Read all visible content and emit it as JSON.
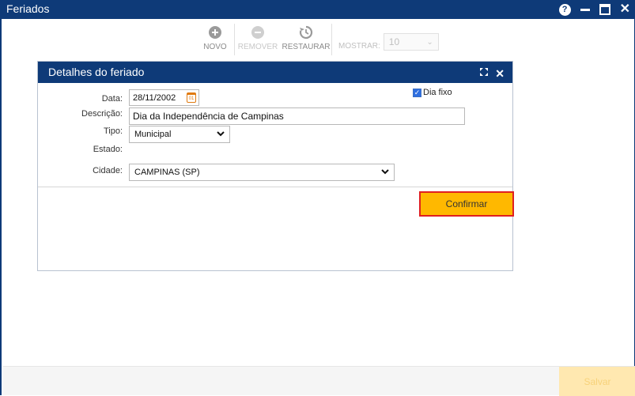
{
  "window": {
    "title": "Feriados"
  },
  "toolbar": {
    "novo": "NOVO",
    "remover": "REMOVER",
    "restaurar": "RESTAURAR",
    "mostrar_label": "MOSTRAR:",
    "mostrar_value": "10"
  },
  "dialog": {
    "title": "Detalhes do feriado",
    "fields": {
      "data_label": "Data:",
      "data_value": "28/11/2002",
      "calendar_day": "01",
      "descricao_label": "Descrição:",
      "descricao_value": "Dia da Independência de Campinas",
      "tipo_label": "Tipo:",
      "tipo_value": "Municipal",
      "estado_label": "Estado:",
      "cidade_label": "Cidade:",
      "cidade_value": "CAMPINAS (SP)",
      "dia_fixo_label": "Dia fixo",
      "dia_fixo_checked": true
    },
    "confirm_label": "Confirmar"
  },
  "footer": {
    "save_label": "Salvar"
  },
  "colors": {
    "header": "#0e3a78",
    "accent": "#ffb800",
    "highlight_border": "#e02020"
  }
}
